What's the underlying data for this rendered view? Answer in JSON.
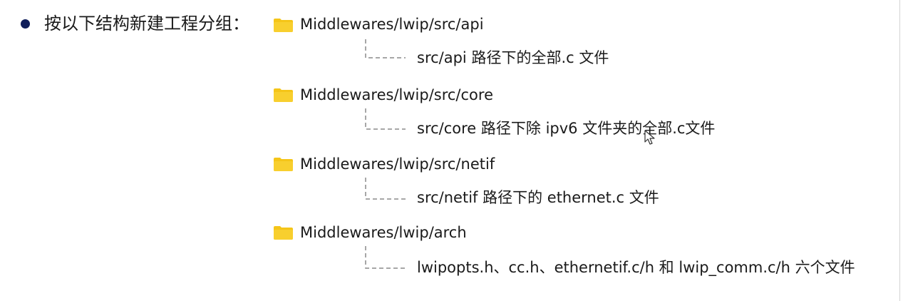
{
  "heading": "按以下结构新建工程分组：",
  "groups": [
    {
      "folder_icon": "folder-icon",
      "path": "Middlewares/lwip/src/api",
      "description": "src/api 路径下的全部.c 文件"
    },
    {
      "folder_icon": "folder-icon",
      "path": "Middlewares/lwip/src/core",
      "description": "src/core 路径下除 ipv6 文件夹的全部.c文件"
    },
    {
      "folder_icon": "folder-icon",
      "path": "Middlewares/lwip/src/netif",
      "description": "src/netif 路径下的 ethernet.c 文件"
    },
    {
      "folder_icon": "folder-icon",
      "path": "Middlewares/lwip/arch",
      "description": "lwipopts.h、cc.h、ethernetif.c/h 和 lwip_comm.c/h 六个文件"
    }
  ],
  "colors": {
    "bullet": "#0f1d5a",
    "folder": "#f5c518",
    "connector": "#8a8a8a",
    "text": "#1a1a1a"
  },
  "cursor_icon": "mouse-pointer-icon"
}
